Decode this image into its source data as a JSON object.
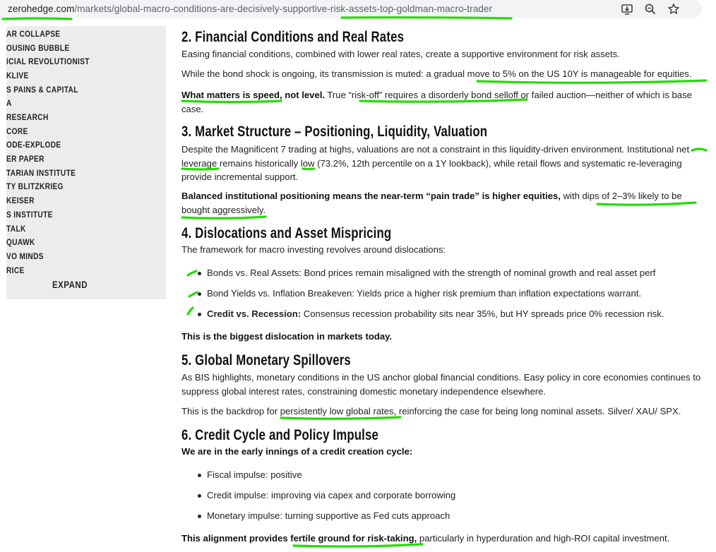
{
  "browser": {
    "url_domain": "zerohedge.com",
    "url_path": "/markets/global-macro-conditions-are-decisively-supportive-risk-assets-top-goldman-macro-trader",
    "icons": [
      "install-app-icon",
      "zoom-icon",
      "bookmark-star-icon"
    ]
  },
  "sidebar": {
    "items": [
      "AR COLLAPSE",
      "OUSING BUBBLE",
      "ICIAL REVOLUTIONIST",
      "KLIVE",
      "S PAINS & CAPITAL",
      "A",
      "RESEARCH",
      " CORE",
      "ODE-EXPLODE",
      "ER PAPER",
      "TARIAN INSTITUTE",
      "TY BLITZKRIEG",
      "KEISER",
      "S INSTITUTE",
      " TALK",
      "QUAWK",
      "VO MINDS",
      "RICE"
    ],
    "expand_label": "EXPAND"
  },
  "article": {
    "s2_title": "2. Financial Conditions and Real Rates",
    "s2_p1": "Easing financial conditions, combined with lower real rates, create a supportive environment for risk assets.",
    "s2_p2": "While the bond shock is ongoing, its transmission is muted: a gradual move to 5% on the US 10Y is manageable for equities.",
    "s2_p3_bold": "What matters is speed, not level.",
    "s2_p3_rest": " True “risk-off” requires a disorderly bond selloff or failed auction—neither of which is base case.",
    "s3_title": "3. Market Structure – Positioning, Liquidity, Valuation",
    "s3_p1": "Despite the Magnificent 7 trading at highs, valuations are not a constraint in this liquidity-driven environment. Institutional net leverage remains historically low (73.2%, 12th percentile on a 1Y lookback), while retail flows and systematic re-leveraging provide incremental support.",
    "s3_p2_bold": "Balanced institutional positioning means the near-term “pain trade” is higher equities,",
    "s3_p2_rest": " with dips of 2–3% likely to be bought aggressively.",
    "s4_title": "4. Dislocations and Asset Mispricing",
    "s4_intro": "The framework for macro investing revolves around dislocations:",
    "s4_b1": "Bonds vs. Real Assets: Bond prices remain misaligned with the strength of nominal growth and real asset perf",
    "s4_b2": "Bond Yields vs. Inflation Breakeven: Yields price a higher risk premium than inflation expectations warrant.",
    "s4_b3_bold": "Credit vs. Recession:",
    "s4_b3_rest": " Consensus recession probability sits near 35%, but HY spreads price 0% recession risk.",
    "s4_close": "This is the biggest dislocation in markets today.",
    "s5_title": "5. Global Monetary Spillovers",
    "s5_p1": "As BIS highlights, monetary conditions in the US anchor global financial conditions. Easy policy in core economies continues to suppress global interest rates, constraining domestic monetary independence elsewhere.",
    "s5_p2": "This is the backdrop for persistently low global rates, reinforcing the case for being long nominal assets. Silver/ XAU/ SPX.",
    "s6_title": "6. Credit Cycle and Policy Impulse",
    "s6_intro": "We are in the early innings of a credit creation cycle:",
    "s6_b1": "Fiscal impulse: positive",
    "s6_b2": "Credit impulse: improving via capex and corporate borrowing",
    "s6_b3": "Monetary impulse: turning supportive as Fed cuts approach",
    "s6_close_bold": "This alignment provides fertile ground for risk-taking,",
    "s6_close_rest": " particularly in hyperduration and high-ROI capital investment."
  },
  "colors": {
    "highlight": "#22dd00",
    "sidebar_bg": "#ececec",
    "url_bar_bg": "#f1f3f4"
  }
}
